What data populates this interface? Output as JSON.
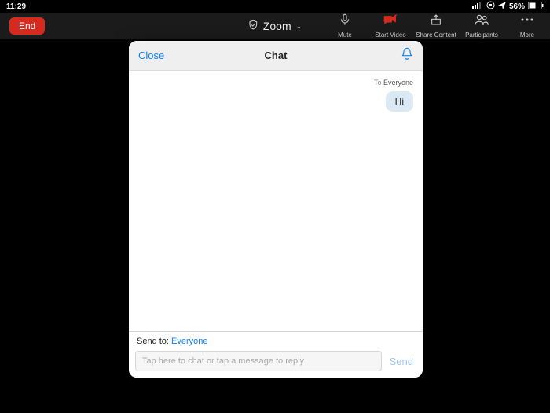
{
  "status": {
    "time": "11:29",
    "battery_text": "56%"
  },
  "topbar": {
    "end_label": "End",
    "title": "Zoom",
    "controls": {
      "mute": "Mute",
      "start_video": "Start Video",
      "share": "Share Content",
      "participants": "Participants",
      "more": "More"
    }
  },
  "chat": {
    "close_label": "Close",
    "title": "Chat",
    "to_prefix": "To",
    "to_recipient": "Everyone",
    "messages": [
      {
        "text": "Hi"
      }
    ],
    "sendto_label": "Send to:",
    "sendto_recipient": "Everyone",
    "input_placeholder": "Tap here to chat or tap a message to reply",
    "send_label": "Send"
  }
}
